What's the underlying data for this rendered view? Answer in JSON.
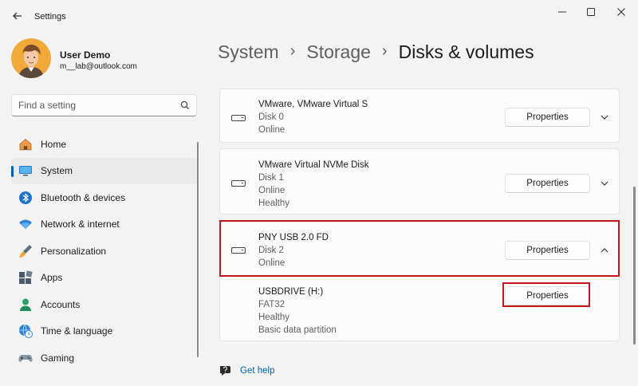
{
  "app": {
    "title": "Settings"
  },
  "profile": {
    "name": "User Demo",
    "email": "m__lab@outlook.com"
  },
  "search": {
    "placeholder": "Find a setting"
  },
  "nav": [
    {
      "label": "Home",
      "icon": "home-icon",
      "active": false
    },
    {
      "label": "System",
      "icon": "system-icon",
      "active": true
    },
    {
      "label": "Bluetooth & devices",
      "icon": "bluetooth-icon",
      "active": false
    },
    {
      "label": "Network & internet",
      "icon": "wifi-icon",
      "active": false
    },
    {
      "label": "Personalization",
      "icon": "brush-icon",
      "active": false
    },
    {
      "label": "Apps",
      "icon": "apps-icon",
      "active": false
    },
    {
      "label": "Accounts",
      "icon": "accounts-icon",
      "active": false
    },
    {
      "label": "Time & language",
      "icon": "globe-clock-icon",
      "active": false
    },
    {
      "label": "Gaming",
      "icon": "gamepad-icon",
      "active": false
    }
  ],
  "breadcrumb": [
    "System",
    "Storage",
    "Disks & volumes"
  ],
  "disks": [
    {
      "name": "VMware, VMware Virtual S",
      "lines": [
        "Disk 0",
        "Online"
      ],
      "button": "Properties",
      "expanded": false
    },
    {
      "name": "VMware Virtual NVMe Disk",
      "lines": [
        "Disk 1",
        "Online",
        "Healthy"
      ],
      "button": "Properties",
      "expanded": false
    },
    {
      "name": "PNY USB 2.0 FD",
      "lines": [
        "Disk 2",
        "Online"
      ],
      "button": "Properties",
      "expanded": true
    }
  ],
  "volume": {
    "name": "USBDRIVE (H:)",
    "lines": [
      "FAT32",
      "Healthy",
      "Basic data partition"
    ],
    "button": "Properties"
  },
  "help": {
    "label": "Get help"
  },
  "colors": {
    "accent": "#005fb8",
    "highlight": "#c4161c",
    "background": "#f3f3f3"
  }
}
